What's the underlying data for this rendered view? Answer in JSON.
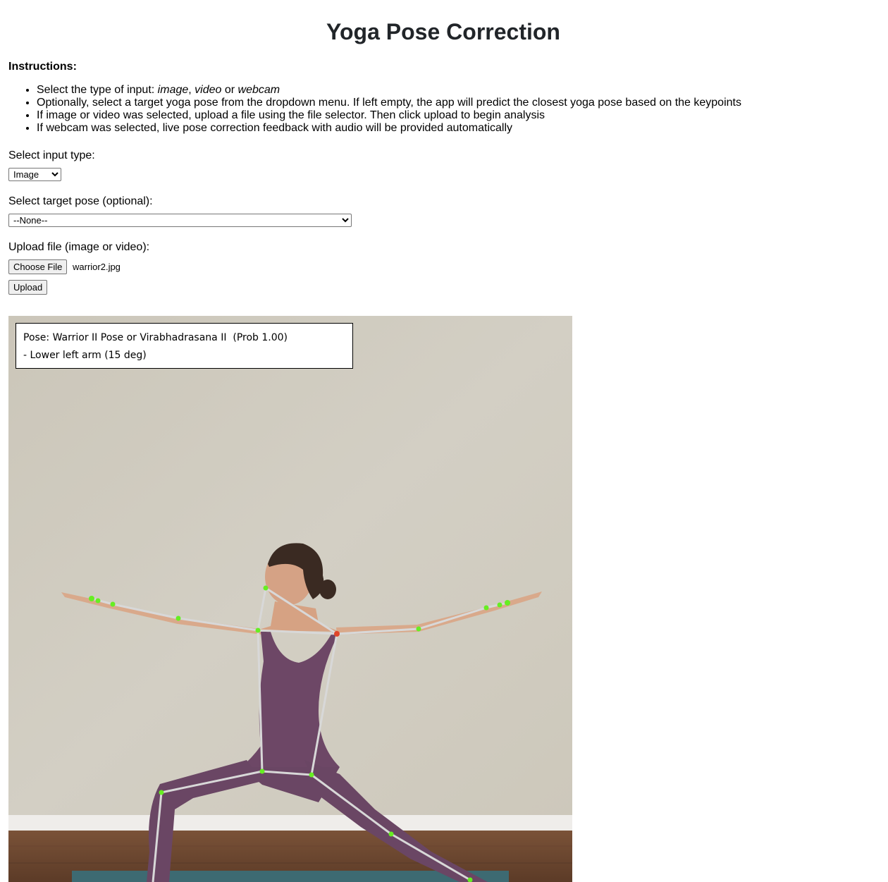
{
  "page": {
    "title": "Yoga Pose Correction"
  },
  "instructions": {
    "title": "Instructions:",
    "item1": {
      "prefix": "Select the type of input: ",
      "opt1": "image",
      "sep1": ", ",
      "opt2": "video",
      "sep2": " or ",
      "opt3": "webcam"
    },
    "item2": "Optionally, select a target yoga pose from the dropdown menu. If left empty, the app will predict the closest yoga pose based on the keypoints",
    "item3": "If image or video was selected, upload a file using the file selector. Then click upload to begin analysis",
    "item4": "If webcam was selected, live pose correction feedback with audio will be provided automatically"
  },
  "form": {
    "input_type_label": "Select input type:",
    "input_type_value": "Image",
    "target_pose_label": "Select target pose (optional):",
    "target_pose_value": "--None--",
    "upload_label": "Upload file (image or video):",
    "choose_file_button": "Choose File",
    "file_name": "warrior2.jpg",
    "upload_button": "Upload"
  },
  "result": {
    "pose_line": "Pose: Warrior II Pose or Virabhadrasana II  (Prob 1.00)",
    "correction_line": "- Lower left arm (15 deg)",
    "colors": {
      "ok_keypoint": "#66ee22",
      "bad_keypoint": "#e0452a",
      "skeleton": "#d8d8d8"
    }
  }
}
